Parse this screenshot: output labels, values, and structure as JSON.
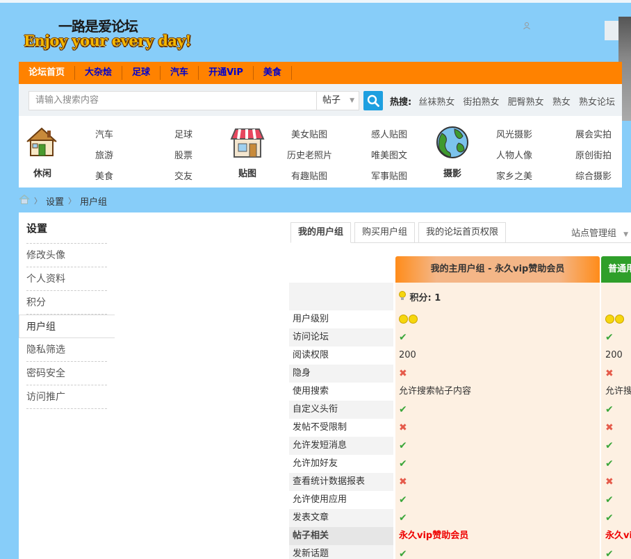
{
  "logo": {
    "cn": "一路是爱论坛",
    "en": "Enjoy your every day!"
  },
  "nav": [
    "论坛首页",
    "大杂烩",
    "足球",
    "汽车",
    "开通ViP",
    "美食"
  ],
  "search": {
    "placeholder": "请输入搜索内容",
    "type": "帖子",
    "hot_label": "热搜:",
    "hot": [
      "丝袜熟女",
      "街拍熟女",
      "肥臀熟女",
      "熟女",
      "熟女论坛"
    ]
  },
  "categories": [
    {
      "title": "休闲",
      "icon": "house-icon",
      "links": [
        "汽车",
        "足球",
        "旅游",
        "股票",
        "美食",
        "交友"
      ]
    },
    {
      "title": "贴图",
      "icon": "shop-icon",
      "links": [
        "美女贴图",
        "感人贴图",
        "历史老照片",
        "唯美图文",
        "有趣贴图",
        "军事贴图"
      ]
    },
    {
      "title": "摄影",
      "icon": "globe-icon",
      "links": [
        "风光摄影",
        "展会实拍",
        "人物人像",
        "原创街拍",
        "家乡之美",
        "综合摄影"
      ]
    }
  ],
  "breadcrumb": [
    "设置",
    "用户组"
  ],
  "sidebar": {
    "title": "设置",
    "items": [
      "修改头像",
      "个人资料",
      "积分",
      "用户组",
      "隐私筛选",
      "密码安全",
      "访问推广"
    ]
  },
  "tabs": [
    "我的用户组",
    "购买用户组",
    "我的论坛首页权限"
  ],
  "tab_right": "站点管理组",
  "group": {
    "main_header": "我的主用户组 - 永久vip赞助会员",
    "other_header": "普通用",
    "score_label": "积分: 1"
  },
  "rows": [
    {
      "label": "用户级别",
      "v1": "smile",
      "v2": "smile"
    },
    {
      "label": "访问论坛",
      "v1": "ok",
      "v2": "ok"
    },
    {
      "label": "阅读权限",
      "v1": "200",
      "v2": "200"
    },
    {
      "label": "隐身",
      "v1": "no",
      "v2": "no"
    },
    {
      "label": "使用搜索",
      "v1": "允许搜索帖子内容",
      "v2": "允许搜"
    },
    {
      "label": "自定义头衔",
      "v1": "ok",
      "v2": "ok"
    },
    {
      "label": "发帖不受限制",
      "v1": "no",
      "v2": "no"
    },
    {
      "label": "允许发短消息",
      "v1": "ok",
      "v2": "ok"
    },
    {
      "label": "允许加好友",
      "v1": "ok",
      "v2": "ok"
    },
    {
      "label": "查看统计数据报表",
      "v1": "no",
      "v2": "no"
    },
    {
      "label": "允许使用应用",
      "v1": "ok",
      "v2": "ok"
    },
    {
      "label": "发表文章",
      "v1": "ok",
      "v2": "ok"
    },
    {
      "label": "帖子相关",
      "v1": "永久vip赞助会员",
      "v2": "永久vi",
      "section": true
    },
    {
      "label": "发新话题",
      "v1": "ok",
      "v2": "ok"
    }
  ]
}
